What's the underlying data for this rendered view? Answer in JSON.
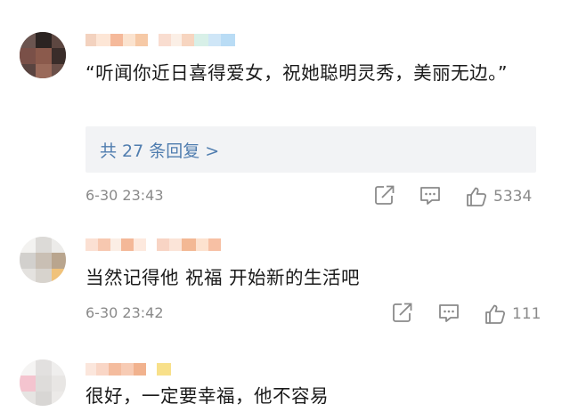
{
  "comments": [
    {
      "text": "“听闻你近日喜得爱女，祝她聪明灵秀，美丽无边。”",
      "replies_label": "共 27 条回复 >",
      "time": "6-30 23:43",
      "likes": "5334"
    },
    {
      "text": "当然记得他 祝福  开始新的生活吧",
      "time": "6-30 23:42",
      "likes": "111"
    },
    {
      "text": "很好，一定要幸福，他不容易"
    }
  ],
  "icons": {
    "share": "share-icon",
    "comment": "comment-icon",
    "like": "thumbs-up-icon"
  },
  "colors": {
    "link": "#507daf",
    "meta": "#8a8a8a",
    "text": "#1a1a1a",
    "reply_bg": "#f2f3f5"
  }
}
